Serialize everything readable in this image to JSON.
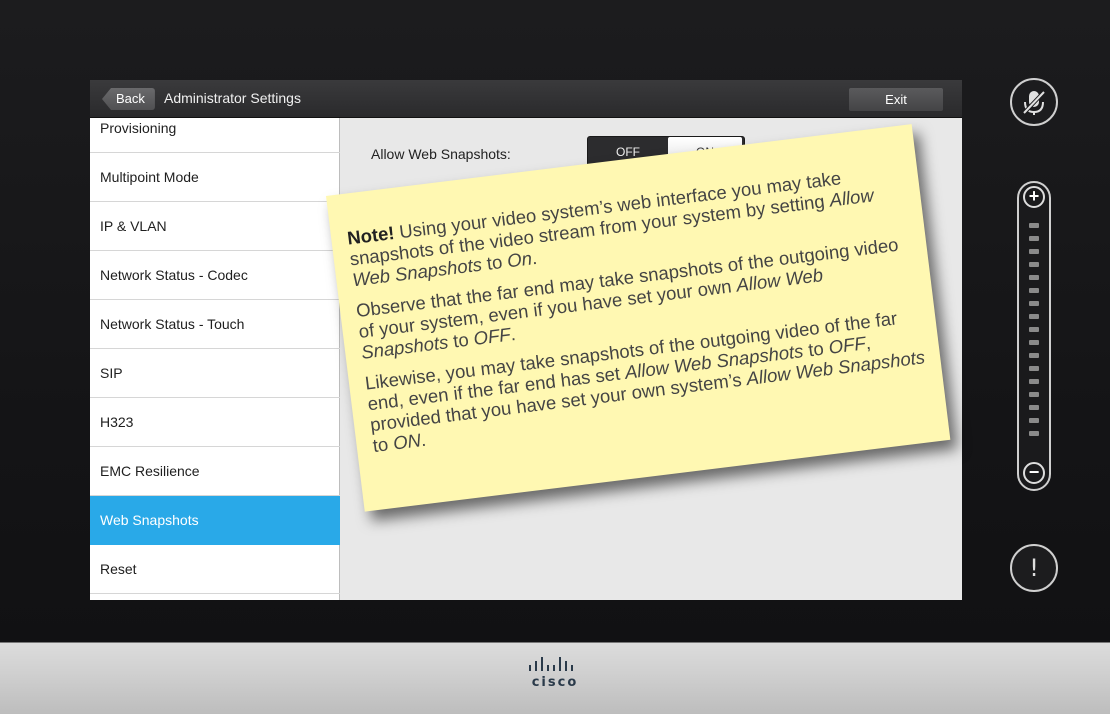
{
  "header": {
    "back_label": "Back",
    "title": "Administrator Settings",
    "exit_label": "Exit"
  },
  "sidebar": {
    "items": [
      {
        "label": "Provisioning"
      },
      {
        "label": "Multipoint Mode"
      },
      {
        "label": "IP & VLAN"
      },
      {
        "label": "Network Status - Codec"
      },
      {
        "label": "Network Status - Touch"
      },
      {
        "label": "SIP"
      },
      {
        "label": "H323"
      },
      {
        "label": "EMC Resilience"
      },
      {
        "label": "Web Snapshots"
      },
      {
        "label": "Reset"
      }
    ],
    "active_index": 8
  },
  "content": {
    "setting_label": "Allow Web Snapshots:",
    "toggle": {
      "off_label": "OFF",
      "on_label": "ON",
      "selected": "ON"
    }
  },
  "note": {
    "p1_lead": "Note!",
    "p1_a": " Using your video system’s web interface you may take snapshots of the video stream from your system by setting ",
    "p1_em": "Allow Web Snapshots",
    "p1_b": " to ",
    "p1_em2": "On",
    "p1_c": ".",
    "p2_a": "Observe that the far end may take snapshots of the outgoing video of your system, even if you have set your own ",
    "p2_em": "Allow Web Snapshots",
    "p2_b": " to ",
    "p2_em2": "OFF",
    "p2_c": ".",
    "p3_a": "Likewise, you may take snapshots of the outgoing video of the far end, even if the far end has set ",
    "p3_em": "Allow Web Snapshots",
    "p3_b": " to ",
    "p3_em2": "OFF",
    "p3_c": ", provided that you have set your own system’s ",
    "p3_em3": "Allow Web Snapshots",
    "p3_d": " to ",
    "p3_em4": "ON",
    "p3_e": "."
  },
  "controls": {
    "volume_plus": "+",
    "volume_minus": "−",
    "alert_symbol": "!",
    "mute_icon": "microphone-muted-icon"
  },
  "brand": {
    "name": "cisco"
  },
  "colors": {
    "accent": "#29a9e8",
    "note": "#fff8b2"
  }
}
